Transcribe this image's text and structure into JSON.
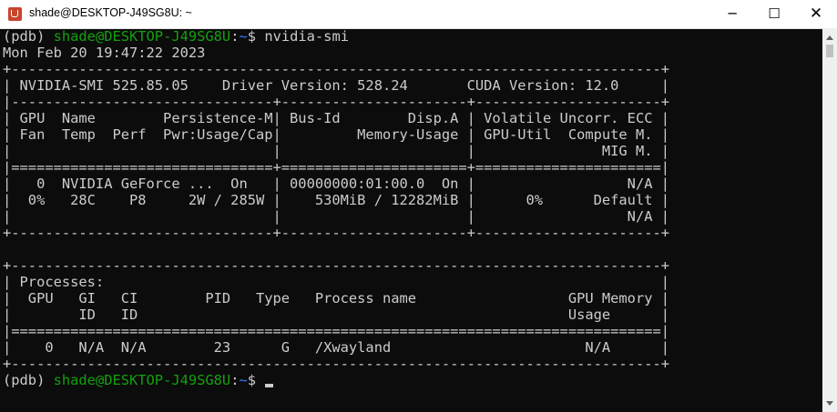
{
  "window": {
    "title": "shade@DESKTOP-J49SG8U: ~",
    "minimize_label": "─",
    "maximize_label": "☐",
    "close_label": "✕"
  },
  "prompt": {
    "env": "(pdb) ",
    "user_host": "shade@DESKTOP-J49SG8U",
    "separator": ":",
    "path": "~",
    "symbol": "$ ",
    "command": "nvidia-smi"
  },
  "output_lines": [
    "Mon Feb 20 19:47:22 2023",
    "+-----------------------------------------------------------------------------+",
    "| NVIDIA-SMI 525.85.05    Driver Version: 528.24       CUDA Version: 12.0     |",
    "|-------------------------------+----------------------+----------------------+",
    "| GPU  Name        Persistence-M| Bus-Id        Disp.A | Volatile Uncorr. ECC |",
    "| Fan  Temp  Perf  Pwr:Usage/Cap|         Memory-Usage | GPU-Util  Compute M. |",
    "|                               |                      |               MIG M. |",
    "|===============================+======================+======================|",
    "|   0  NVIDIA GeForce ...  On   | 00000000:01:00.0  On |                  N/A |",
    "|  0%   28C    P8     2W / 285W |    530MiB / 12282MiB |      0%      Default |",
    "|                               |                      |                  N/A |",
    "+-------------------------------+----------------------+----------------------+",
    "",
    "+-----------------------------------------------------------------------------+",
    "| Processes:                                                                  |",
    "|  GPU   GI   CI        PID   Type   Process name                  GPU Memory |",
    "|        ID   ID                                                   Usage      |",
    "|=============================================================================|",
    "|    0   N/A  N/A        23      G   /Xwayland                       N/A      |",
    "+-----------------------------------------------------------------------------+"
  ],
  "colors": {
    "background": "#0c0c0c",
    "foreground": "#cccccc",
    "prompt_green": "#13a10e",
    "path_blue": "#3b78ff",
    "app_icon": "#c8442c"
  },
  "icons": {
    "app": "ubuntu-terminal-icon",
    "minimize": "minimize-icon",
    "maximize": "maximize-icon",
    "close": "close-icon"
  }
}
